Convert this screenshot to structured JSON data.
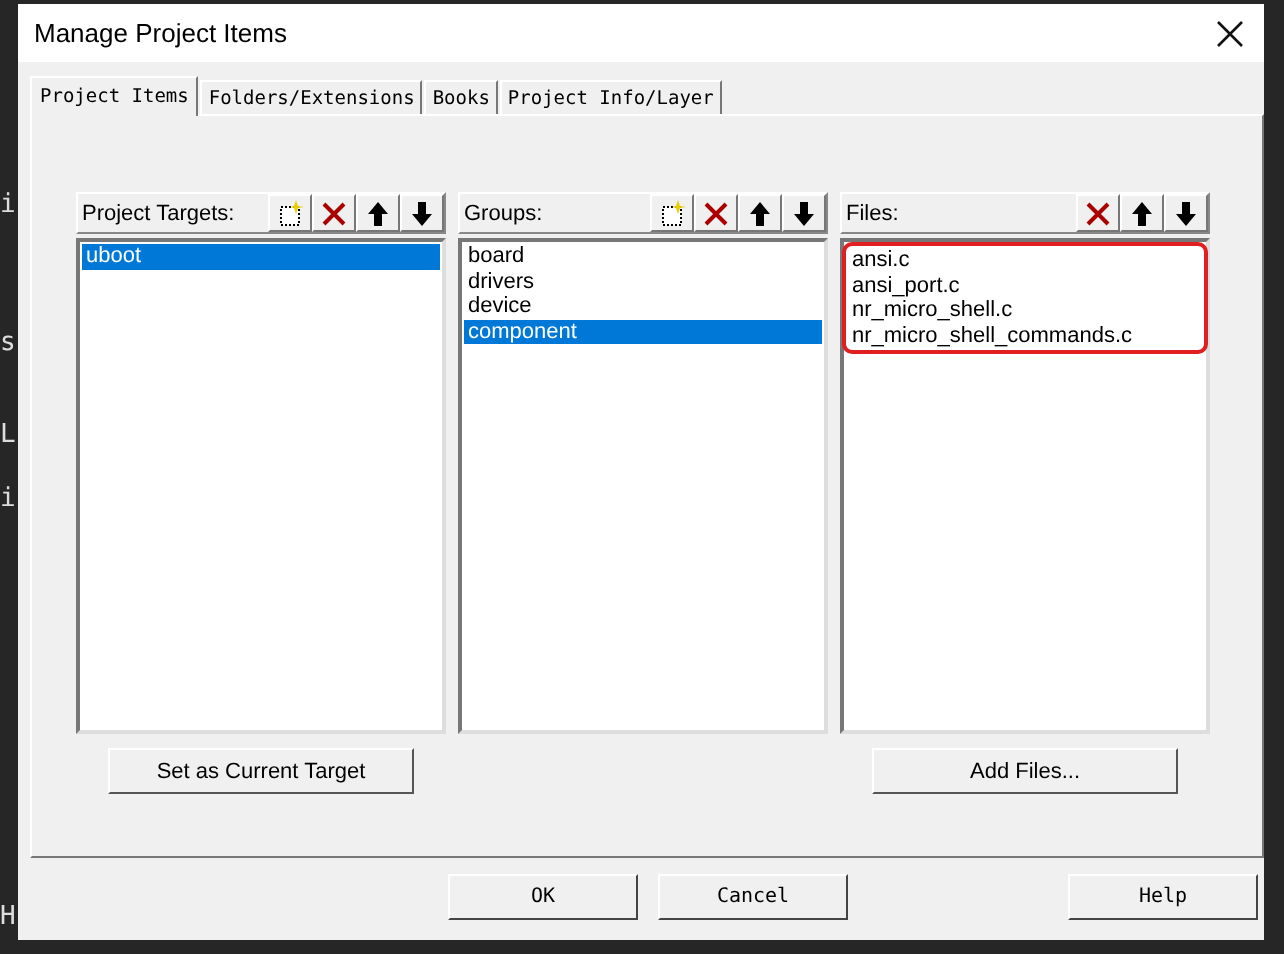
{
  "editor_fragments": [
    "i",
    "s",
    "L",
    "i",
    "H"
  ],
  "window": {
    "title": "Manage Project Items"
  },
  "tabs": [
    {
      "label": "Project Items",
      "selected": true
    },
    {
      "label": "Folders/Extensions",
      "selected": false
    },
    {
      "label": "Books",
      "selected": false
    },
    {
      "label": "Project Info/Layer",
      "selected": false
    }
  ],
  "panels": [
    {
      "title": "Project Targets:",
      "tools": [
        {
          "kind": "new"
        },
        {
          "kind": "delete"
        },
        {
          "kind": "up"
        },
        {
          "kind": "down"
        }
      ],
      "highlighted": false,
      "items": [
        {
          "label": "uboot",
          "selected": true
        }
      ],
      "button": "Set as Current Target"
    },
    {
      "title": "Groups:",
      "tools": [
        {
          "kind": "new"
        },
        {
          "kind": "delete"
        },
        {
          "kind": "up"
        },
        {
          "kind": "down"
        }
      ],
      "highlighted": false,
      "items": [
        {
          "label": "board",
          "selected": false
        },
        {
          "label": "drivers",
          "selected": false
        },
        {
          "label": "device",
          "selected": false
        },
        {
          "label": "component",
          "selected": true
        }
      ]
    },
    {
      "title": "Files:",
      "tools": [
        {
          "kind": "delete"
        },
        {
          "kind": "up"
        },
        {
          "kind": "down"
        }
      ],
      "highlighted": true,
      "items": [
        {
          "label": "ansi.c",
          "selected": false
        },
        {
          "label": "ansi_port.c",
          "selected": false
        },
        {
          "label": "nr_micro_shell.c",
          "selected": false
        },
        {
          "label": "nr_micro_shell_commands.c",
          "selected": false
        }
      ],
      "button": "Add Files..."
    }
  ],
  "buttons": [
    "OK",
    "Cancel",
    "Help"
  ]
}
